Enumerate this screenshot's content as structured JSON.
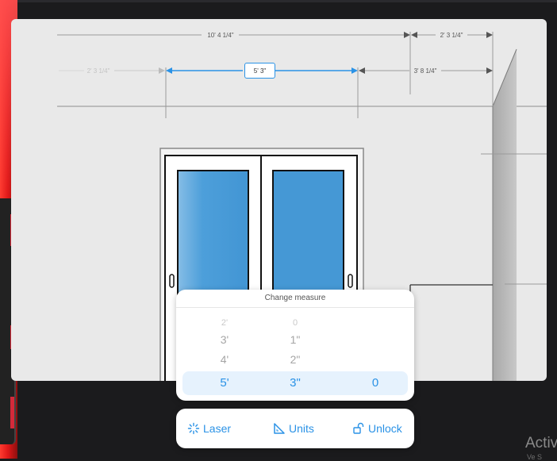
{
  "dimensions": {
    "overall_width": "10' 4 1/4\"",
    "right_wall_segment": "2' 3 1/4\"",
    "left_offset": "2' 3 1/4\"",
    "selected_width": "5' 3\"",
    "right_offset": "3' 8 1/4\""
  },
  "picker": {
    "title": "Change measure",
    "feet_column": [
      "2'",
      "3'",
      "4'",
      "5'"
    ],
    "inches_column": [
      "0",
      "1\"",
      "2\"",
      "3\""
    ],
    "fraction_selected": "0",
    "accent_color": "#2a92e6"
  },
  "toolbar": {
    "laser": "Laser",
    "units": "Units",
    "unlock": "Unlock"
  },
  "watermark": {
    "text": "Activ",
    "sub": "Ve S"
  },
  "colors": {
    "device_red": "#e01818",
    "window_glass": "#4d9fda",
    "canvas_bg": "#e9e9e9"
  }
}
